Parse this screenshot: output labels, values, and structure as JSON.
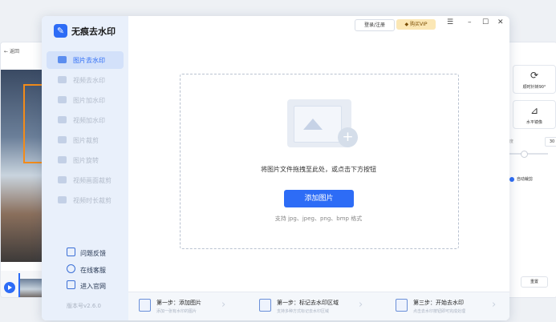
{
  "left_panel": {
    "back_label": "返回"
  },
  "right_panel": {
    "rotate_label": "顺时针转90°",
    "flip_label": "水平镜像",
    "value": "30",
    "unit": "度",
    "auto_crop_label": "自动裁剪",
    "reset_label": "重置"
  },
  "app": {
    "title": "无痕去水印",
    "version": "版本号v2.6.0"
  },
  "sidebar": {
    "items": [
      {
        "label": "图片去水印",
        "active": true
      },
      {
        "label": "视频去水印",
        "active": false
      },
      {
        "label": "图片加水印",
        "active": false
      },
      {
        "label": "视频加水印",
        "active": false
      },
      {
        "label": "图片裁剪",
        "active": false
      },
      {
        "label": "图片旋转",
        "active": false
      },
      {
        "label": "视频画面裁剪",
        "active": false
      },
      {
        "label": "视频时长裁剪",
        "active": false
      }
    ],
    "links": [
      {
        "label": "问题反馈"
      },
      {
        "label": "在线客服"
      },
      {
        "label": "进入官网"
      }
    ]
  },
  "titlebar": {
    "login_label": "登录/注册",
    "vip_label": "购买VIP",
    "vip_icon": "diamond-icon",
    "menu_icon": "hamburger-icon"
  },
  "content": {
    "drop_hint": "将图片文件拖拽至此处，或点击下方按钮",
    "add_button": "添加图片",
    "formats": "支持 jpg、jpeg、png、bmp 格式"
  },
  "steps": [
    {
      "title": "第一步：添加图片",
      "desc": "添加一张有水印的图片"
    },
    {
      "title": "第一步：标记去水印区域",
      "desc": "支持多种方式标记去水印区域"
    },
    {
      "title": "第三步：开始去水印",
      "desc": "点击去水印按钮即可完成处理"
    }
  ],
  "colors": {
    "accent": "#2d6cf6",
    "sidebar_bg": "#e9f0fb",
    "vip_bg": "#fbe7b5"
  }
}
